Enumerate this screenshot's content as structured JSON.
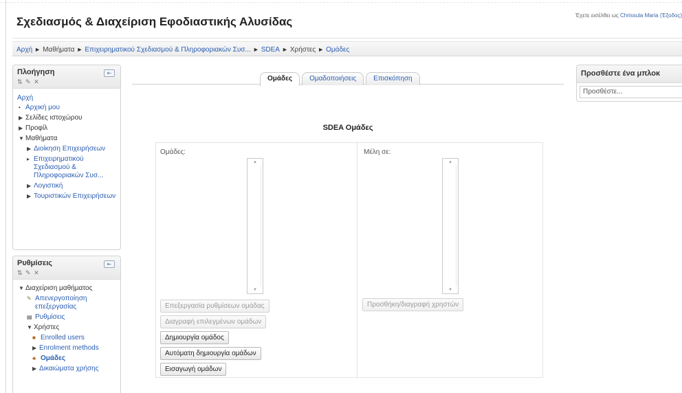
{
  "header": {
    "site_title": "Σχεδιασμός & Διαχείριση Εφοδιαστικής Αλυσίδας",
    "login_prefix": "Έχετε εισέλθει ως",
    "login_user": "Chrissula Maria (Έξοδος)"
  },
  "breadcrumb": [
    {
      "label": "Αρχή",
      "link": true
    },
    {
      "label": "Μαθήματα",
      "link": false
    },
    {
      "label": "Επιχειρηματικού Σχεδιασμού & Πληροφοριακών Συσ...",
      "link": true
    },
    {
      "label": "SDEA",
      "link": true
    },
    {
      "label": "Χρήστες",
      "link": false
    },
    {
      "label": "Ομάδες",
      "link": true
    }
  ],
  "navigation": {
    "title": "Πλοήγηση",
    "home": "Αρχή",
    "items": [
      "Αρχική μου",
      "Σελίδες ιστοχώρου",
      "Προφίλ",
      "Μαθήματα"
    ],
    "courses": [
      "Διοίκηση Επιχειρήσεων",
      "Επιχειρηματικού Σχεδιασμού & Πληροφοριακών Συσ...",
      "Λογιστική",
      "Τουριστικών Επιχειρήσεων"
    ]
  },
  "settings": {
    "title": "Ρυθμίσεις",
    "course_admin": "Διαχείριση μαθήματος",
    "turn_editing": "Απενεργοποίηση επεξεργασίας",
    "settings_link": "Ρυθμίσεις",
    "users": "Χρήστες",
    "enrolled_users": "Enrolled users",
    "enrolment_methods": "Enrolment methods",
    "groups": "Ομάδες",
    "permissions": "Δικαιώματα χρήσης"
  },
  "tabs": [
    {
      "label": "Ομάδες",
      "active": true
    },
    {
      "label": "Ομαδοποιήσεις",
      "active": false
    },
    {
      "label": "Επισκόπηση",
      "active": false
    }
  ],
  "main": {
    "heading": "SDEA Ομάδες",
    "groups_label": "Ομάδες:",
    "members_label": "Μέλη σε:",
    "btn_edit_group_settings": "Επεξεργασία ρυθμίσεων ομάδας",
    "btn_delete_selected": "Διαγραφή επιλεγμένων ομάδων",
    "btn_create_group": "Δημιουργία ομάδος",
    "btn_auto_create": "Αυτόματη δημιουργία ομάδων",
    "btn_import": "Εισαγωγή ομάδων",
    "btn_add_remove_users": "Προσθήκη/διαγραφή χρηστών"
  },
  "add_block": {
    "title": "Προσθέστε ένα μπλοκ",
    "select_value": "Προσθέστε..."
  },
  "colors": {
    "link": "#2a5db0",
    "border": "#d2d2d2"
  }
}
